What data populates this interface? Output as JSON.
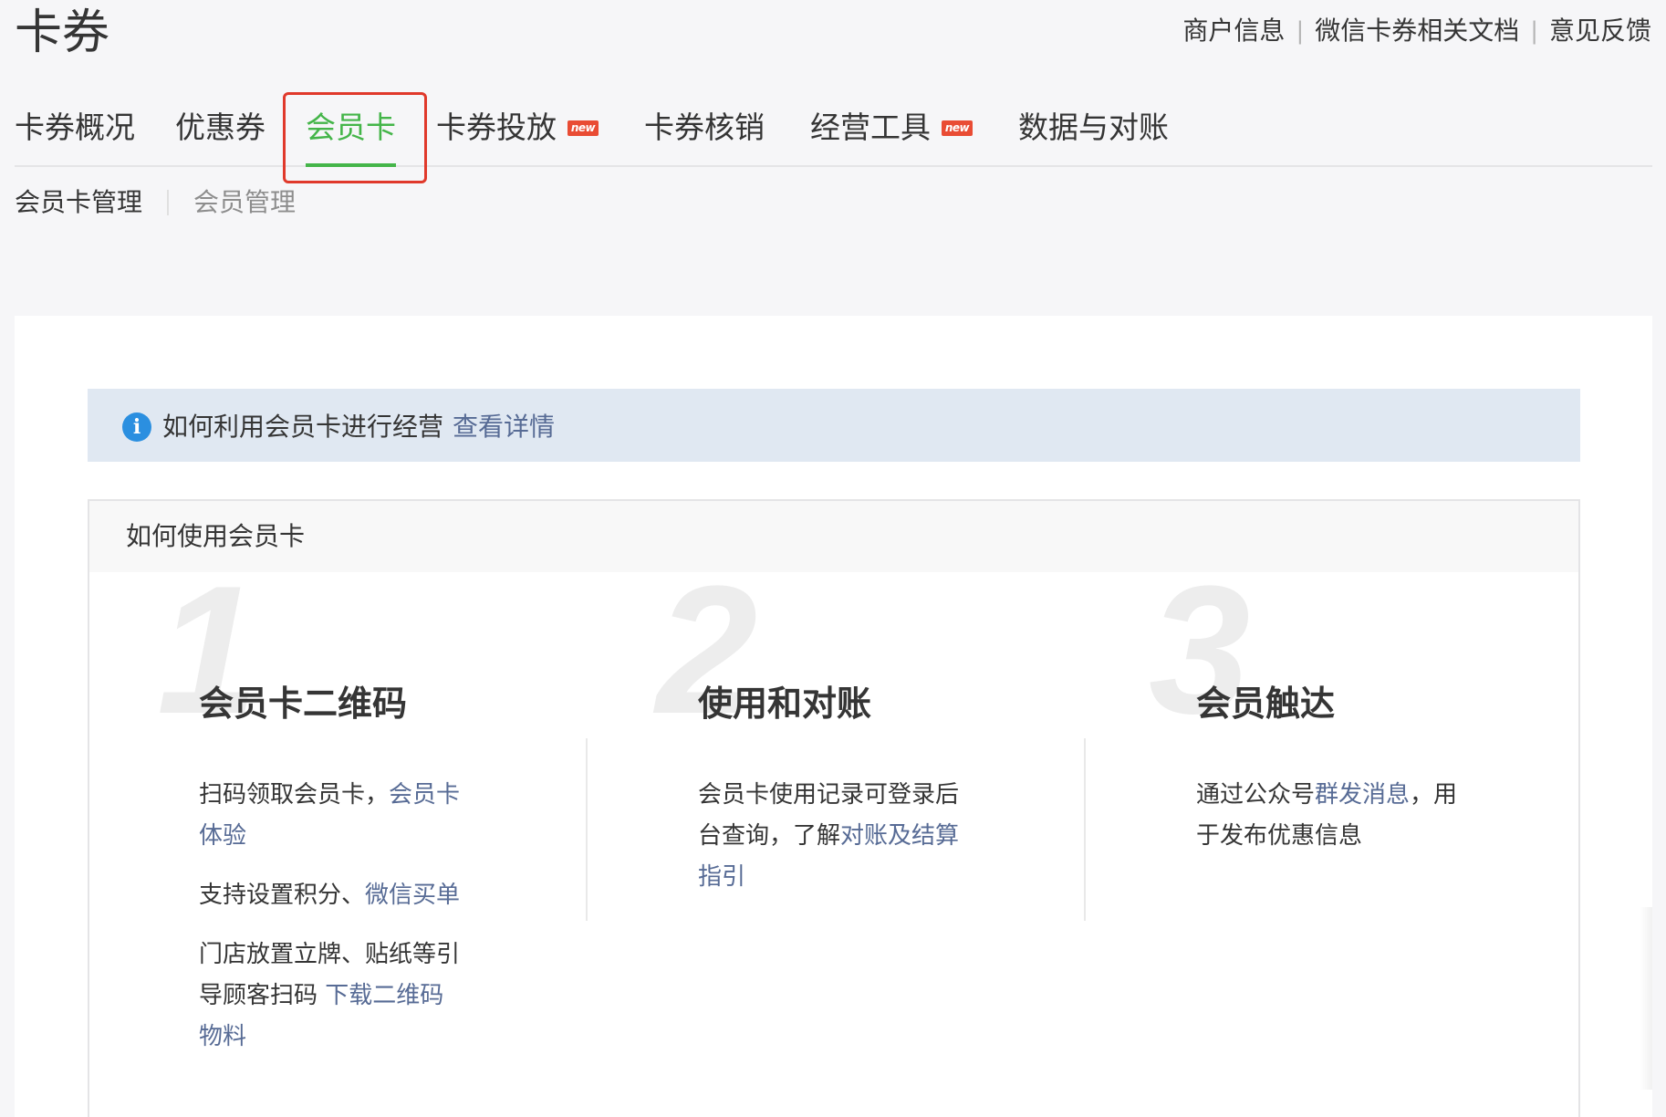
{
  "page": {
    "title": "卡券"
  },
  "top_links": [
    {
      "label": "商户信息"
    },
    {
      "label": "微信卡券相关文档"
    },
    {
      "label": "意见反馈"
    }
  ],
  "top_links_separator": "|",
  "main_tabs": [
    {
      "label": "卡券概况",
      "active": false,
      "new": false
    },
    {
      "label": "优惠券",
      "active": false,
      "new": false
    },
    {
      "label": "会员卡",
      "active": true,
      "new": false
    },
    {
      "label": "卡券投放",
      "active": false,
      "new": true
    },
    {
      "label": "卡券核销",
      "active": false,
      "new": false
    },
    {
      "label": "经营工具",
      "active": false,
      "new": true
    },
    {
      "label": "数据与对账",
      "active": false,
      "new": false
    }
  ],
  "new_badge_text": "new",
  "sub_nav": [
    {
      "label": "会员卡管理",
      "active": true
    },
    {
      "label": "会员管理",
      "active": false
    }
  ],
  "info_banner": {
    "text": "如何利用会员卡进行经营",
    "link": "查看详情",
    "icon": "info-icon",
    "icon_glyph": "i"
  },
  "howto": {
    "title": "如何使用会员卡",
    "steps": [
      {
        "number": "1",
        "title": "会员卡二维码",
        "paras": [
          [
            {
              "t": "扫码领取会员卡，"
            },
            {
              "t": "会员卡体验",
              "link": true
            }
          ],
          [
            {
              "t": "支持设置积分、"
            },
            {
              "t": "微信买单",
              "link": true
            }
          ],
          [
            {
              "t": "门店放置立牌、贴纸等引导顾客扫码 "
            },
            {
              "t": "下载二维码物料",
              "link": true
            }
          ]
        ]
      },
      {
        "number": "2",
        "title": "使用和对账",
        "paras": [
          [
            {
              "t": "会员卡使用记录可登录后台查询，了解"
            },
            {
              "t": "对账及结算指引",
              "link": true
            }
          ]
        ]
      },
      {
        "number": "3",
        "title": "会员触达",
        "paras": [
          [
            {
              "t": "通过公众号"
            },
            {
              "t": "群发消息",
              "link": true
            },
            {
              "t": "，用于发布优惠信息"
            }
          ]
        ]
      }
    ]
  },
  "colors": {
    "accent_green": "#44b549",
    "link_blue": "#576b95",
    "new_badge": "#e94c34",
    "highlight_red": "#e0392b",
    "banner_bg": "#e0e8f2",
    "info_icon": "#2b8fe0"
  }
}
